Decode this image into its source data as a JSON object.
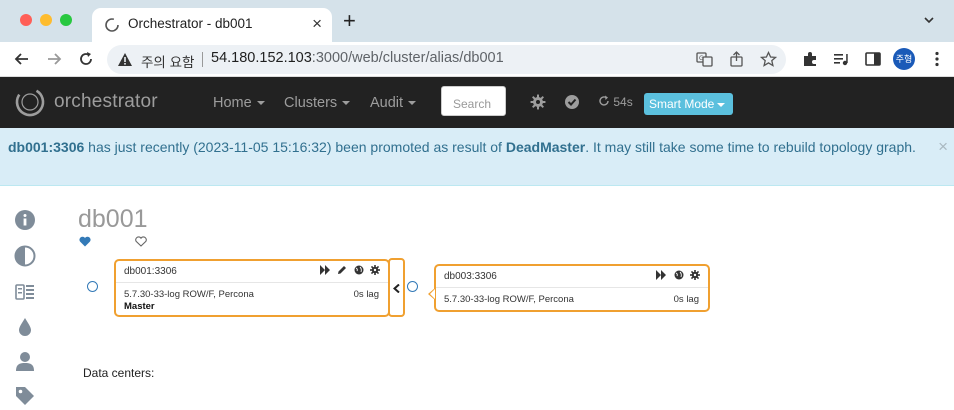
{
  "browser": {
    "tab_title": "Orchestrator - db001",
    "tab_close": "×",
    "new_tab": "+",
    "security_status": "주의 요함",
    "url_host": "54.180.152.103",
    "url_path": ":3000/web/cluster/alias/db001",
    "profile_initials": "주형"
  },
  "navbar": {
    "brand": "orchestrator",
    "menu": [
      "Home",
      "Clusters",
      "Audit"
    ],
    "search_placeholder": "Search",
    "refresh_label": "54s",
    "smart_mode_label": "Smart Mode",
    "icons": [
      "gear-icon",
      "check-circle-icon",
      "refresh-icon"
    ]
  },
  "alert": {
    "host": "db001:3306",
    "text_1": " has just recently (2023-11-05 15:16:32) been promoted as result of ",
    "reason": "DeadMaster",
    "text_2": ". It may still take some time to rebuild topology graph.",
    "close": "×"
  },
  "sidebar": {
    "icons": [
      "info-icon",
      "contrast-icon",
      "list-icon",
      "drop-icon",
      "user-icon",
      "tag-icon"
    ]
  },
  "cluster": {
    "title": "db001",
    "nodes": [
      {
        "name": "db001:3306",
        "version": "5.7.30-33-log ROW/F, Percona",
        "lag": "0s lag",
        "role": "Master",
        "actions": [
          "forward-icon",
          "pencil-icon",
          "globe-icon",
          "gear-icon"
        ]
      },
      {
        "name": "db003:3306",
        "version": "5.7.30-33-log ROW/F, Percona",
        "lag": "0s lag",
        "role": "",
        "actions": [
          "forward-icon",
          "globe-icon",
          "gear-icon"
        ]
      }
    ],
    "data_centers_label": "Data centers:"
  },
  "colors": {
    "navbar_bg": "#222222",
    "alert_bg": "#d9edf7",
    "alert_text": "#31708f",
    "node_border": "#f0a030",
    "smart_mode_bg": "#5bc0de",
    "side_icon": "#7f8c99"
  }
}
